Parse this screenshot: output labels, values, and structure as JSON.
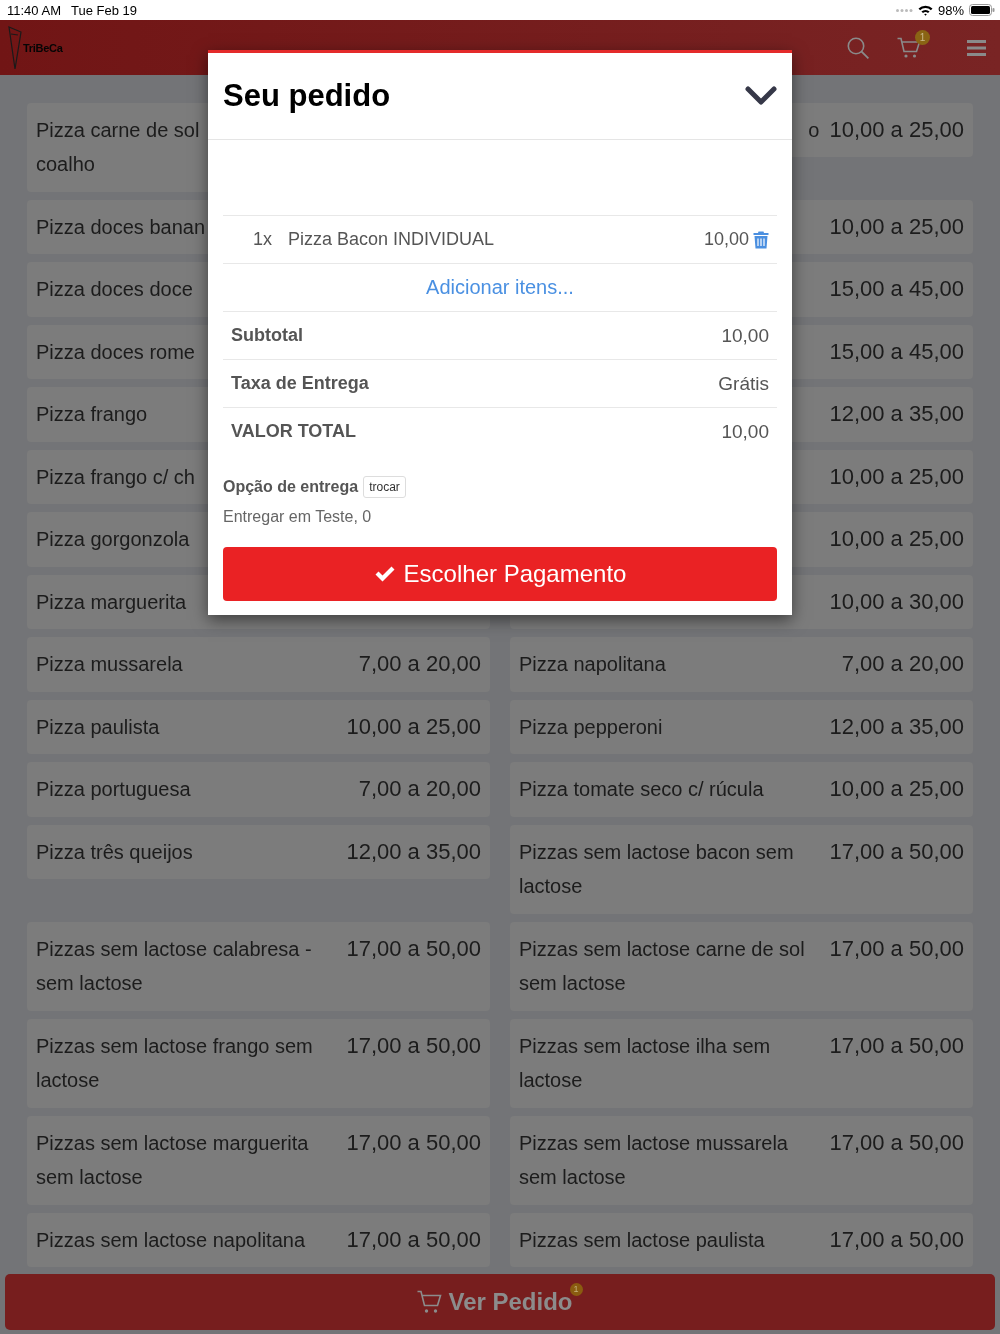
{
  "status_bar": {
    "time": "11:40 AM",
    "date": "Tue Feb 19",
    "battery": "98%"
  },
  "header": {
    "logo": "TriBeCa",
    "cart_badge": "1"
  },
  "menu_items": [
    {
      "name": "Pizza carne de sol\ncoalho"
    },
    {
      "name": "o",
      "truncated_start": true,
      "price": "10,00 a 25,00"
    },
    {
      "name": "Pizza doces banan"
    },
    {
      "price": "10,00 a 25,00"
    },
    {
      "name": "Pizza doces doce"
    },
    {
      "price": "15,00 a 45,00"
    },
    {
      "name": "Pizza doces rome"
    },
    {
      "price": "15,00 a 45,00"
    },
    {
      "name": "Pizza frango"
    },
    {
      "price": "12,00 a 35,00"
    },
    {
      "name": "Pizza frango c/ ch"
    },
    {
      "price": "10,00 a 25,00"
    },
    {
      "name": "Pizza gorgonzola"
    },
    {
      "price": "10,00 a 25,00"
    },
    {
      "name": "Pizza marguerita"
    },
    {
      "price": "10,00 a 30,00"
    },
    {
      "name": "Pizza mussarela",
      "price": "7,00 a 20,00"
    },
    {
      "name": "Pizza napolitana",
      "price": "7,00 a 20,00"
    },
    {
      "name": "Pizza paulista",
      "price": "10,00 a 25,00"
    },
    {
      "name": "Pizza pepperoni",
      "price": "12,00 a 35,00"
    },
    {
      "name": "Pizza portuguesa",
      "price": "7,00 a 20,00"
    },
    {
      "name": "Pizza tomate seco c/ rúcula",
      "price": "10,00 a 25,00"
    },
    {
      "name": "Pizza três queijos",
      "price": "12,00 a 35,00"
    },
    {
      "name": "Pizzas sem lactose bacon sem lactose",
      "price": "17,00 a 50,00"
    },
    {
      "name": "Pizzas sem lactose calabresa - sem lactose",
      "price": "17,00 a 50,00"
    },
    {
      "name": "Pizzas sem lactose carne de sol sem lactose",
      "price": "17,00 a 50,00"
    },
    {
      "name": "Pizzas sem lactose frango sem lactose",
      "price": "17,00 a 50,00"
    },
    {
      "name": "Pizzas sem lactose ilha sem lactose",
      "price": "17,00 a 50,00"
    },
    {
      "name": "Pizzas sem lactose marguerita sem lactose",
      "price": "17,00 a 50,00"
    },
    {
      "name": "Pizzas sem lactose mussarela sem lactose",
      "price": "17,00 a 50,00"
    },
    {
      "name": "Pizzas sem lactose napolitana",
      "price": "17,00 a 50,00"
    },
    {
      "name": "Pizzas sem lactose paulista",
      "price": "17,00 a 50,00"
    }
  ],
  "order_modal": {
    "title": "Seu pedido",
    "items": [
      {
        "quantity": "1x",
        "name": "Pizza Bacon INDIVIDUAL",
        "price": "10,00"
      }
    ],
    "add_link": "Adicionar itens...",
    "summary": [
      {
        "label": "Subtotal",
        "value": "10,00"
      },
      {
        "label": "Taxa de Entrega",
        "value": "Grátis"
      },
      {
        "label": "VALOR TOTAL",
        "value": "10,00"
      }
    ],
    "delivery": {
      "label": "Opção de entrega",
      "change_button": "trocar",
      "address": "Entregar em Teste, 0"
    },
    "pay_button": "Escolher Pagamento"
  },
  "bottom_bar": {
    "button": "Ver Pedido",
    "badge": "1"
  }
}
